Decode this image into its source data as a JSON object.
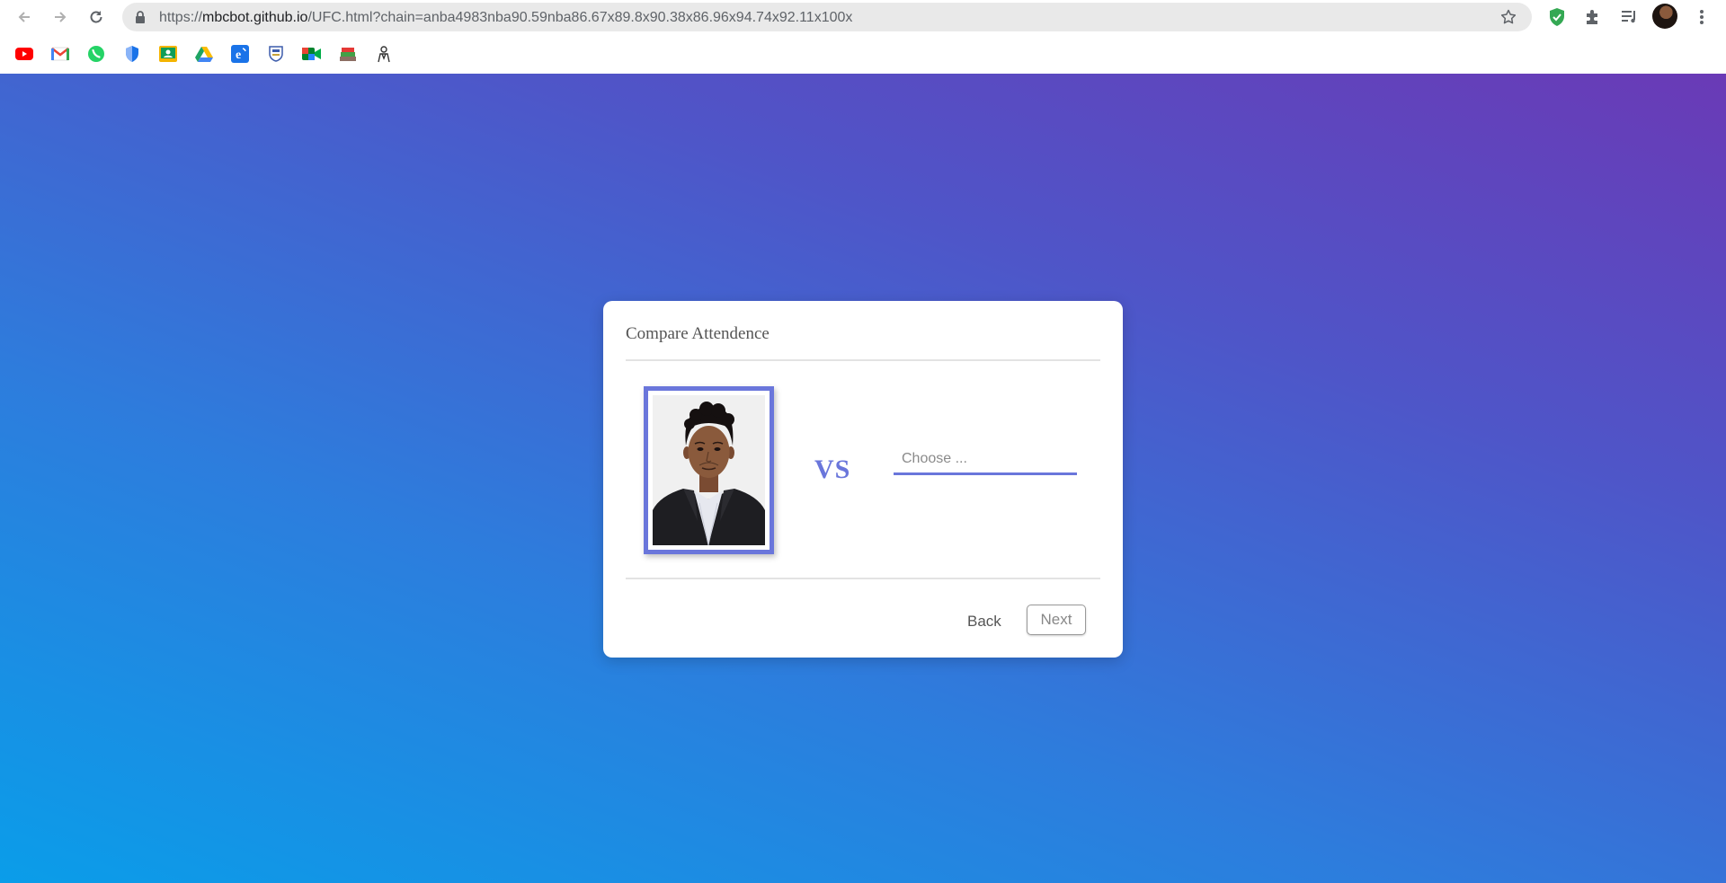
{
  "browser": {
    "url_scheme": "https://",
    "url_host": "mbcbot.github.io",
    "url_path": "/UFC.html?chain=anba4983nba90.59nba86.67x89.8x90.38x86.96x94.74x92.11x100x"
  },
  "bookmarks": [
    {
      "name": "youtube-icon"
    },
    {
      "name": "gmail-icon"
    },
    {
      "name": "whatsapp-icon"
    },
    {
      "name": "shield-icon"
    },
    {
      "name": "google-classroom-icon"
    },
    {
      "name": "google-drive-icon"
    },
    {
      "name": "edge-e-icon"
    },
    {
      "name": "college-crest-icon"
    },
    {
      "name": "google-meet-icon"
    },
    {
      "name": "books-icon"
    },
    {
      "name": "person-sketch-icon"
    }
  ],
  "card": {
    "title": "Compare Attendence",
    "vs_label": "VS",
    "choose_placeholder": "Choose ...",
    "back_label": "Back",
    "next_label": "Next"
  },
  "colors": {
    "accent": "#6a76db",
    "gradient_top": "#6a3ab6",
    "gradient_bottom": "#0a9de9"
  }
}
